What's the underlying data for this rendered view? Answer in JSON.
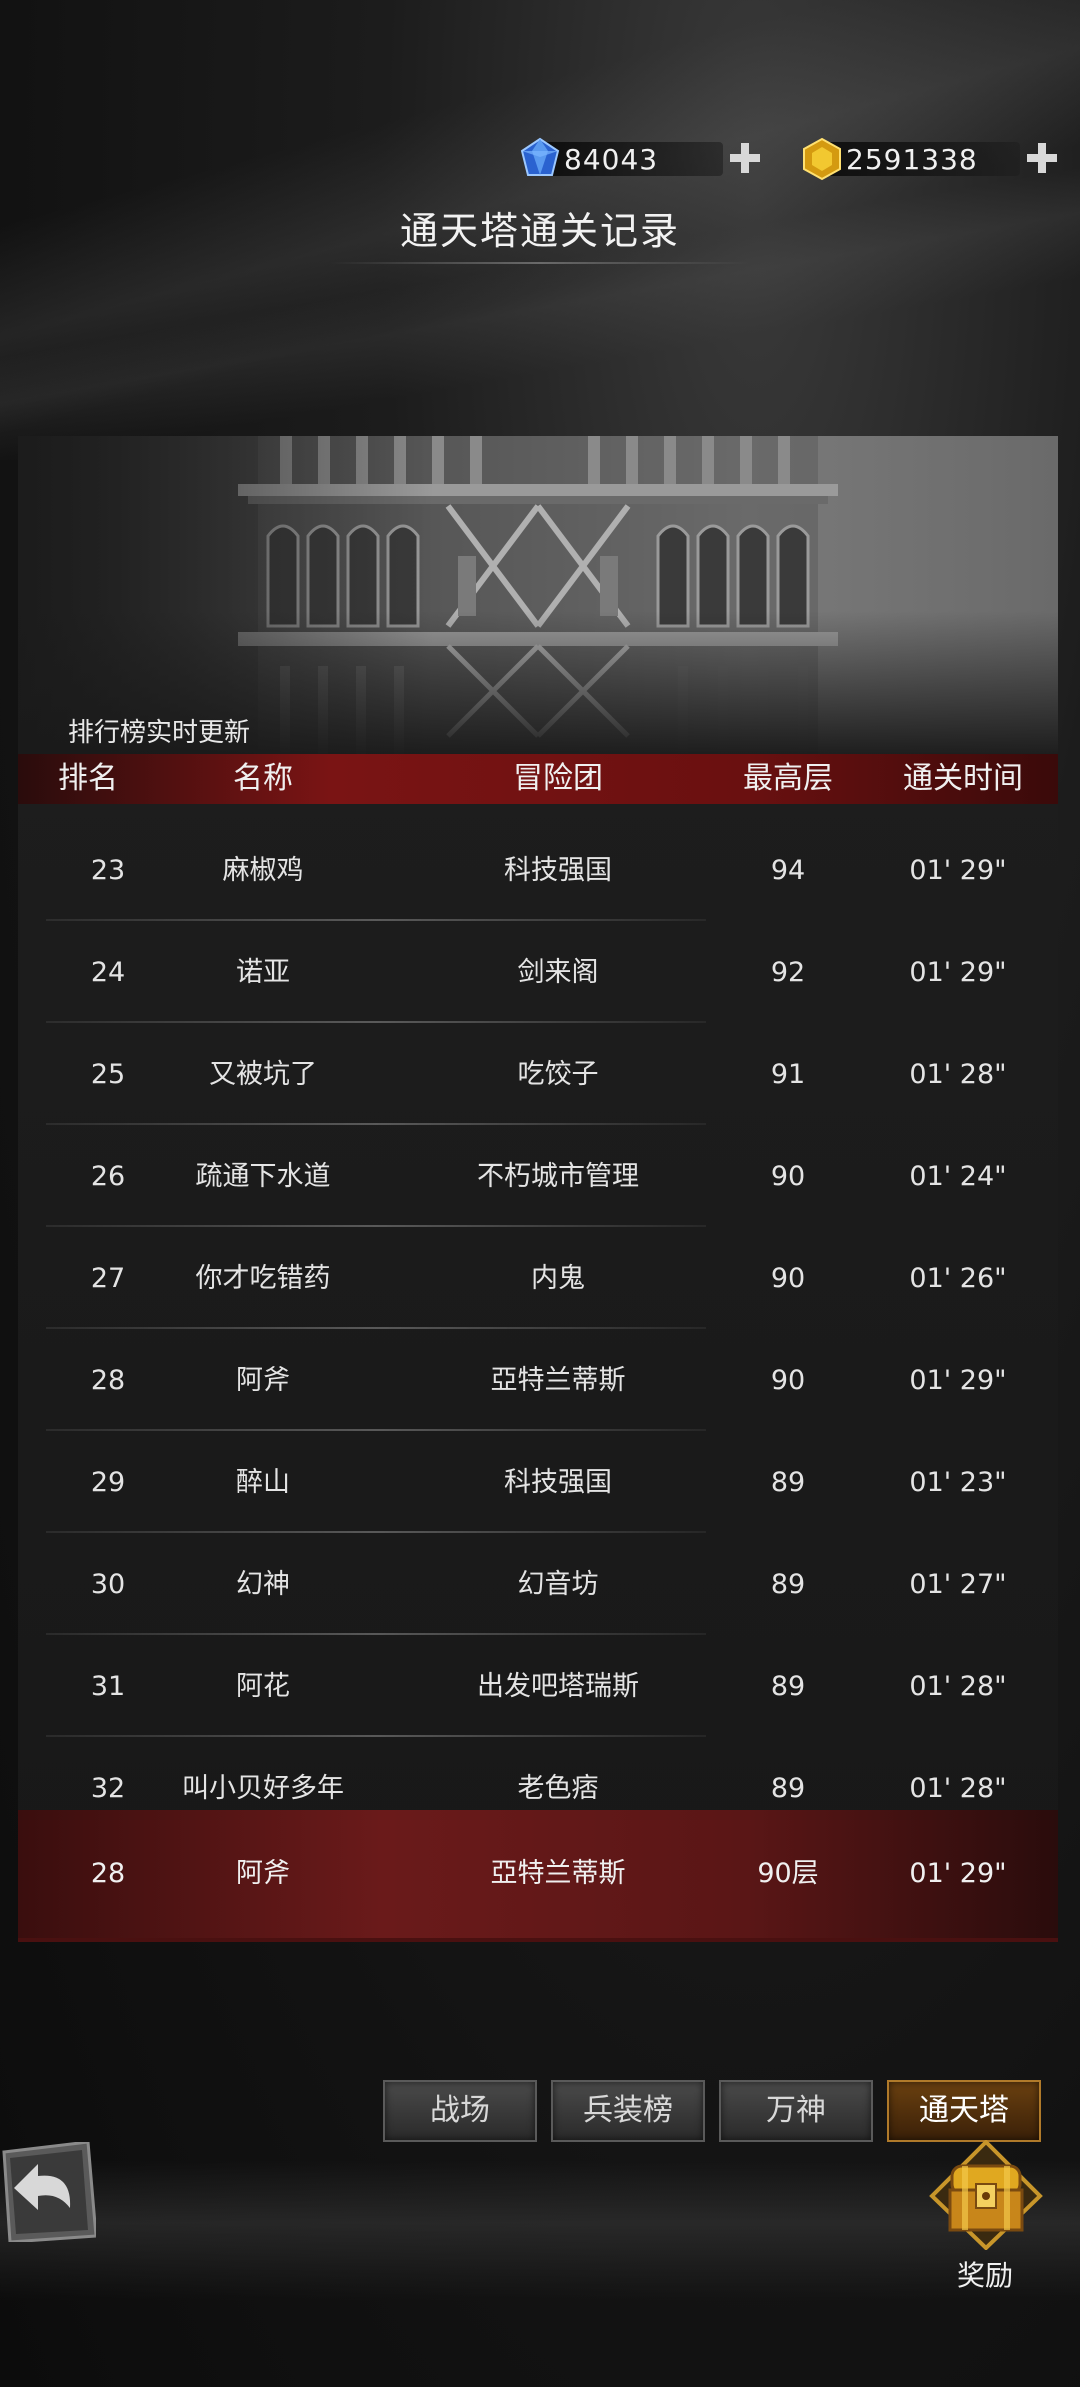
{
  "currency": {
    "diamond": {
      "icon": "blue-diamond-icon",
      "value": "84043"
    },
    "gold": {
      "icon": "gold-coin-icon",
      "value": "2591338"
    }
  },
  "title": "通天塔通关记录",
  "banner": {
    "caption": "排行榜实时更新"
  },
  "table": {
    "headers": {
      "rank": "排名",
      "name": "名称",
      "guild": "冒险团",
      "floor": "最高层",
      "time": "通关时间"
    },
    "rows": [
      {
        "rank": "23",
        "name": "麻椒鸡",
        "guild": "科技强国",
        "floor": "94",
        "time": "01' 29\""
      },
      {
        "rank": "24",
        "name": "诺亚",
        "guild": "剑来阁",
        "floor": "92",
        "time": "01' 29\""
      },
      {
        "rank": "25",
        "name": "又被坑了",
        "guild": "吃饺子",
        "floor": "91",
        "time": "01' 28\""
      },
      {
        "rank": "26",
        "name": "疏通下水道",
        "guild": "不朽城市管理",
        "floor": "90",
        "time": "01' 24\""
      },
      {
        "rank": "27",
        "name": "你才吃错药",
        "guild": "内鬼",
        "floor": "90",
        "time": "01' 26\""
      },
      {
        "rank": "28",
        "name": "阿斧",
        "guild": "亞特兰蒂斯",
        "floor": "90",
        "time": "01' 29\""
      },
      {
        "rank": "29",
        "name": "醉山",
        "guild": "科技强国",
        "floor": "89",
        "time": "01' 23\""
      },
      {
        "rank": "30",
        "name": "幻神",
        "guild": "幻音坊",
        "floor": "89",
        "time": "01' 27\""
      },
      {
        "rank": "31",
        "name": "阿花",
        "guild": "出发吧塔瑞斯",
        "floor": "89",
        "time": "01' 28\""
      },
      {
        "rank": "32",
        "name": "叫小贝好多年",
        "guild": "老色痞",
        "floor": "89",
        "time": "01' 28\""
      }
    ],
    "my_row": {
      "rank": "28",
      "name": "阿斧",
      "guild": "亞特兰蒂斯",
      "floor": "90层",
      "time": "01' 29\""
    }
  },
  "tabs": [
    {
      "label": "战场",
      "active": false
    },
    {
      "label": "兵装榜",
      "active": false
    },
    {
      "label": "万神",
      "active": false
    },
    {
      "label": "通天塔",
      "active": true
    }
  ],
  "reward": {
    "label": "奖励",
    "icon": "treasure-chest-icon"
  },
  "back": {
    "icon": "back-arrow-icon"
  },
  "colors": {
    "accent_red": "#7a1414",
    "active_tab": "#b07a2a",
    "gold": "#e8b820",
    "diamond": "#3a7ae0"
  }
}
